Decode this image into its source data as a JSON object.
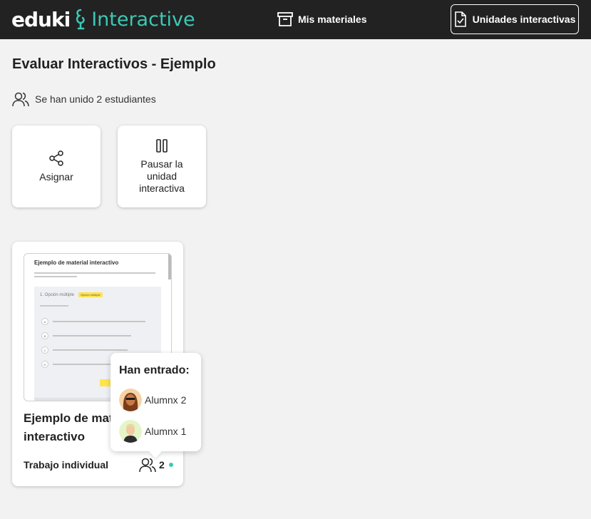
{
  "header": {
    "logo_text": "eduki",
    "logo_product": "Interactive",
    "nav_materials_label": "Mis materiales",
    "nav_units_label": "Unidades interactivas"
  },
  "page": {
    "title": "Evaluar Interactivos - Ejemplo",
    "students_joined": "Se han unido 2 estudiantes"
  },
  "actions": {
    "assign_label": "Asignar",
    "pause_line1": "Pausar la",
    "pause_line2": "unidad",
    "pause_line3": "interactiva"
  },
  "material": {
    "thumbnail_title": "Ejemplo de material interactivo",
    "thumbnail_question": "1. Opción múltiple",
    "thumbnail_tag": "Opción múltiple",
    "thumbnail_options": [
      "A",
      "B",
      "C",
      "D"
    ],
    "title_line1": "Ejemplo de mate",
    "title_line2": "interactivo",
    "mode": "Trabajo individual",
    "participant_count": "2"
  },
  "tooltip": {
    "title": "Han entrado:",
    "users": [
      "Alumnx 2",
      "Alumnx 1"
    ]
  },
  "colors": {
    "topbar": "#222222",
    "accent": "#3cc8b4",
    "background": "#f2f2f2"
  }
}
